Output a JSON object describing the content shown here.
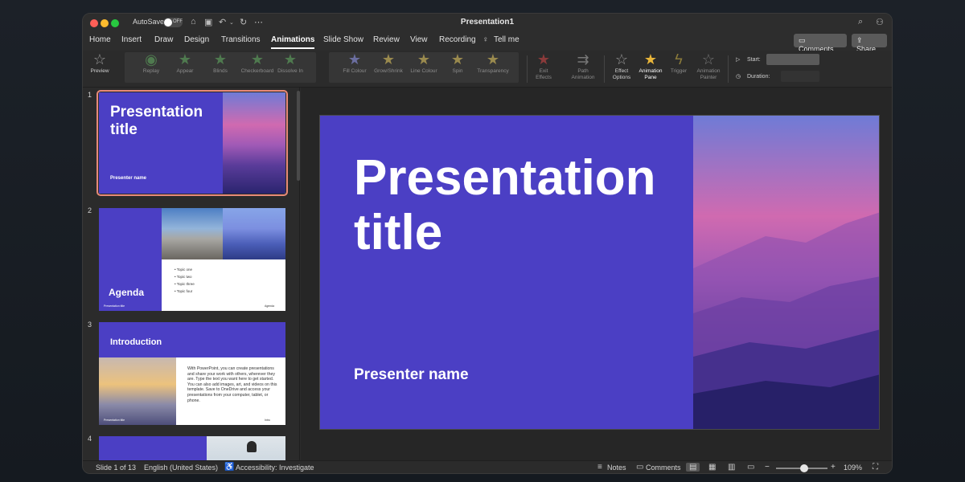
{
  "app": {
    "autosave_label": "AutoSave",
    "autosave_state": "OFF",
    "window_title": "Presentation1"
  },
  "menu": {
    "tabs": [
      "Home",
      "Insert",
      "Draw",
      "Design",
      "Transitions",
      "Animations",
      "Slide Show",
      "Review",
      "View",
      "Recording",
      "Tell me"
    ],
    "active_tab": "Animations",
    "comments_label": "Comments",
    "share_label": "Share"
  },
  "ribbon": {
    "preview": "Preview",
    "entrance": [
      "Replay",
      "Appear",
      "Blinds",
      "Checkerboard",
      "Dissolve In"
    ],
    "emphasis": [
      "Fill Colour",
      "Grow/Shrink",
      "Line Colour",
      "Spin",
      "Transparency"
    ],
    "exit_label": "Exit\nEffects",
    "path_label": "Path\nAnimation",
    "effect_options": "Effect\nOptions",
    "animation_pane": "Animation\nPane",
    "trigger": "Trigger",
    "animation_painter": "Animation\nPainter",
    "start_label": "Start:",
    "duration_label": "Duration:"
  },
  "slides": {
    "numbers": [
      "1",
      "2",
      "3",
      "4"
    ],
    "s1": {
      "title": "Presentation title",
      "presenter": "Presenter name"
    },
    "s2": {
      "title": "Agenda",
      "topics": [
        "Topic one",
        "Topic two",
        "Topic three",
        "Topic four"
      ],
      "footer": "Presentation title",
      "page_label": "Agenda"
    },
    "s3": {
      "title": "Introduction",
      "body": "With PowerPoint, you can create presentations and share your work with others, wherever they are. Type the text you want here to get started. You can also add images, art, and videos on this template. Save to OneDrive and access your presentations from your computer, tablet, or phone.",
      "footer": "Presentation title",
      "page_label": "Intro"
    }
  },
  "main_slide": {
    "title": "Presentation title",
    "presenter": "Presenter name"
  },
  "status": {
    "slide_counter": "Slide 1 of 13",
    "language": "English (United States)",
    "accessibility": "Accessibility: Investigate",
    "notes": "Notes",
    "comments": "Comments",
    "zoom": "109%",
    "zoom_level": 0.55
  },
  "colors": {
    "accent_purple": "#4b3fc4",
    "selected_outline": "#e88a78"
  }
}
